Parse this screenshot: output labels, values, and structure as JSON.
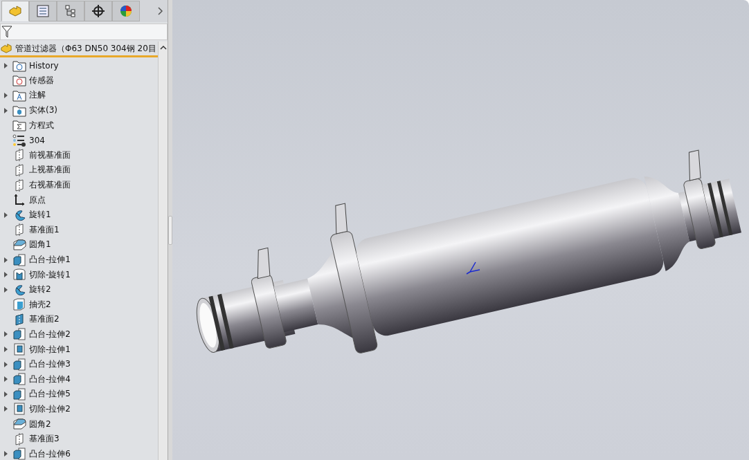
{
  "panel": {
    "tabs": [
      {
        "kind": "features",
        "selected": true
      },
      {
        "kind": "properties",
        "selected": false
      },
      {
        "kind": "config",
        "selected": false
      },
      {
        "kind": "dimxpert",
        "selected": false
      },
      {
        "kind": "display",
        "selected": false
      }
    ],
    "root": {
      "label": "管道过滤器（Φ63 DN50 304钢  20目"
    },
    "tree": [
      {
        "label": "History",
        "kind": "history",
        "collapsed": true
      },
      {
        "label": "传感器",
        "kind": "sensor",
        "collapsed": false
      },
      {
        "label": "注解",
        "kind": "annotation",
        "collapsed": true
      },
      {
        "label": "实体(3)",
        "kind": "solid",
        "collapsed": true
      },
      {
        "label": "方程式",
        "kind": "equation",
        "collapsed": false
      },
      {
        "label": "304",
        "kind": "material",
        "collapsed": false
      },
      {
        "label": "前视基准面",
        "kind": "plane",
        "collapsed": false
      },
      {
        "label": "上视基准面",
        "kind": "plane",
        "collapsed": false
      },
      {
        "label": "右视基准面",
        "kind": "plane",
        "collapsed": false
      },
      {
        "label": "原点",
        "kind": "origin",
        "collapsed": false
      },
      {
        "label": "旋转1",
        "kind": "revolve",
        "collapsed": true
      },
      {
        "label": "基准面1",
        "kind": "plane",
        "collapsed": false
      },
      {
        "label": "圆角1",
        "kind": "fillet",
        "collapsed": false
      },
      {
        "label": "凸台-拉伸1",
        "kind": "extrude",
        "collapsed": true
      },
      {
        "label": "切除-旋转1",
        "kind": "cutrevolve",
        "collapsed": true
      },
      {
        "label": "旋转2",
        "kind": "revolve",
        "collapsed": true
      },
      {
        "label": "抽壳2",
        "kind": "shell",
        "collapsed": false
      },
      {
        "label": "基准面2",
        "kind": "planeblue",
        "collapsed": false
      },
      {
        "label": "凸台-拉伸2",
        "kind": "extrude",
        "collapsed": true
      },
      {
        "label": "切除-拉伸1",
        "kind": "cut",
        "collapsed": true
      },
      {
        "label": "凸台-拉伸3",
        "kind": "extrude",
        "collapsed": true
      },
      {
        "label": "凸台-拉伸4",
        "kind": "extrude",
        "collapsed": true
      },
      {
        "label": "凸台-拉伸5",
        "kind": "extrude",
        "collapsed": true
      },
      {
        "label": "切除-拉伸2",
        "kind": "cut",
        "collapsed": true
      },
      {
        "label": "圆角2",
        "kind": "fillet",
        "collapsed": false
      },
      {
        "label": "基准面3",
        "kind": "plane",
        "collapsed": false
      },
      {
        "label": "凸台-拉伸6",
        "kind": "extrude",
        "collapsed": true
      }
    ]
  }
}
